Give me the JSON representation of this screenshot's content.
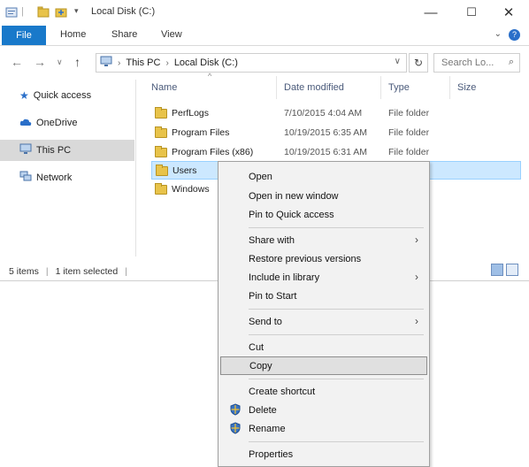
{
  "window": {
    "title": "Local Disk (C:)",
    "quick_access_toolbar": [
      "properties-icon",
      "new-folder-icon",
      "customize-dropdown-icon"
    ],
    "controls": {
      "minimize": "—",
      "maximize": "☐",
      "close": "✕"
    }
  },
  "ribbon": {
    "file_tab": "File",
    "tabs": [
      "Home",
      "Share",
      "View"
    ],
    "expand_glyph": "⌄",
    "help_glyph": "?"
  },
  "address": {
    "crumbs": [
      "This PC",
      "Local Disk (C:)"
    ],
    "search_placeholder": "Search Lo..."
  },
  "nav_pane": {
    "items": [
      {
        "label": "Quick access",
        "icon": "star-icon"
      },
      {
        "label": "OneDrive",
        "icon": "cloud-icon"
      },
      {
        "label": "This PC",
        "icon": "computer-icon",
        "selected": true
      },
      {
        "label": "Network",
        "icon": "network-icon"
      }
    ]
  },
  "file_list": {
    "columns": {
      "name": "Name",
      "date": "Date modified",
      "type": "Type",
      "size": "Size"
    },
    "rows": [
      {
        "name": "PerfLogs",
        "date": "7/10/2015 4:04 AM",
        "type": "File folder"
      },
      {
        "name": "Program Files",
        "date": "10/19/2015 6:35 AM",
        "type": "File folder"
      },
      {
        "name": "Program Files (x86)",
        "date": "10/19/2015 6:31 AM",
        "type": "File folder"
      },
      {
        "name": "Users",
        "date": "",
        "type": "",
        "selected": true
      },
      {
        "name": "Windows",
        "date": "",
        "type": ""
      }
    ]
  },
  "status": {
    "item_count": "5 items",
    "selection": "1 item selected"
  },
  "context_menu": {
    "groups": [
      [
        {
          "label": "Open"
        },
        {
          "label": "Open in new window"
        },
        {
          "label": "Pin to Quick access"
        }
      ],
      [
        {
          "label": "Share with",
          "submenu": true
        },
        {
          "label": "Restore previous versions"
        },
        {
          "label": "Include in library",
          "submenu": true
        },
        {
          "label": "Pin to Start"
        }
      ],
      [
        {
          "label": "Send to",
          "submenu": true
        }
      ],
      [
        {
          "label": "Cut"
        },
        {
          "label": "Copy",
          "highlighted": true
        }
      ],
      [
        {
          "label": "Create shortcut"
        },
        {
          "label": "Delete",
          "icon": "shield-icon"
        },
        {
          "label": "Rename",
          "icon": "shield-icon"
        }
      ],
      [
        {
          "label": "Properties"
        }
      ]
    ]
  },
  "colors": {
    "file_tab_bg": "#1979ca",
    "selection_bg": "#cce8ff",
    "selection_border": "#99d1ff",
    "menu_bg": "#f2f2f2",
    "folder_yellow": "#e8c34a"
  }
}
